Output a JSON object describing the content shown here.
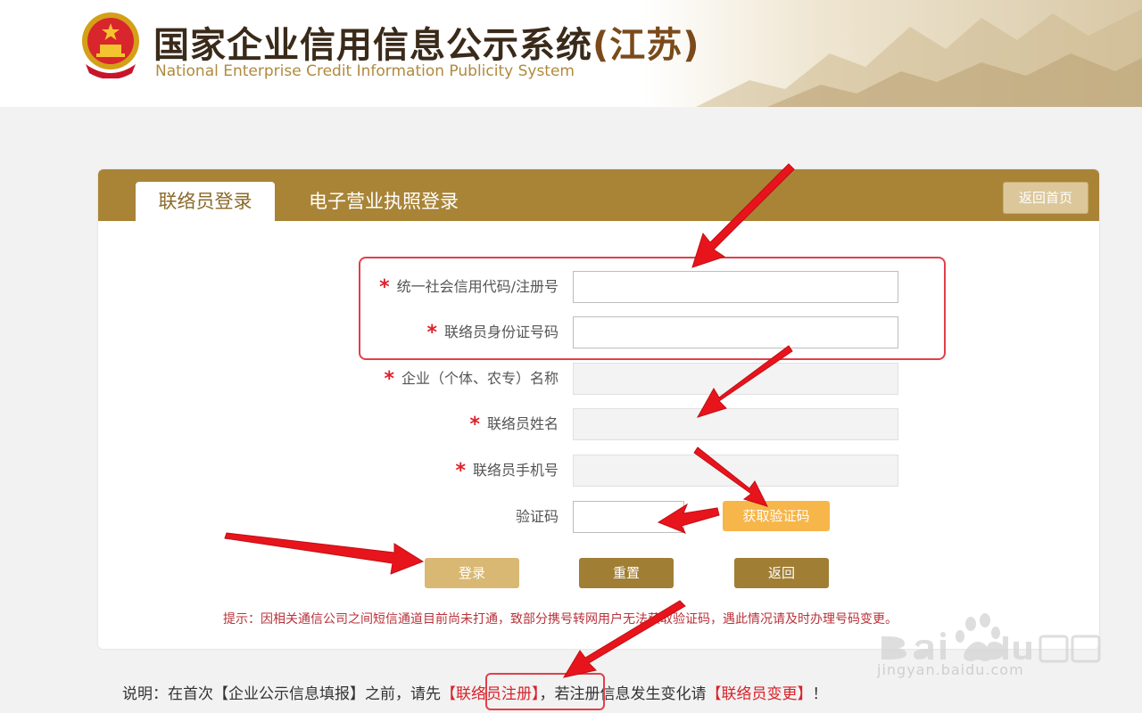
{
  "header": {
    "title_cn": "国家企业信用信息公示系统",
    "title_prov": "(江苏)",
    "title_en": "National Enterprise Credit Information Publicity System"
  },
  "tabs": [
    {
      "label": "联络员登录",
      "active": true
    },
    {
      "label": "电子营业执照登录",
      "active": false
    }
  ],
  "home_button": "返回首页",
  "form": {
    "fields": [
      {
        "label": "统一社会信用代码/注册号",
        "required": true,
        "value": "",
        "readonly": false
      },
      {
        "label": "联络员身份证号码",
        "required": true,
        "value": "",
        "readonly": false
      },
      {
        "label": "企业（个体、农专）名称",
        "required": true,
        "value": "",
        "readonly": true
      },
      {
        "label": "联络员姓名",
        "required": true,
        "value": "",
        "readonly": true
      },
      {
        "label": "联络员手机号",
        "required": true,
        "value": "",
        "readonly": true
      }
    ],
    "captcha": {
      "label": "验证码",
      "value": "",
      "button": "获取验证码"
    },
    "star": "*"
  },
  "buttons": {
    "login": "登录",
    "reset": "重置",
    "back": "返回"
  },
  "tip": "提示：因相关通信公司之间短信通道目前尚未打通，致部分携号转网用户无法获取验证码，遇此情况请及时办理号码变更。",
  "note": {
    "prefix": "说明：在首次【企业公示信息填报】之前，请先",
    "register_link": "【联络员注册】",
    "middle": "，若注册信息发生变化请",
    "change_link": "【联络员变更】",
    "suffix": "！"
  },
  "watermark": {
    "text": "jingyan.baidu.com"
  },
  "colors": {
    "brand": "#a98437",
    "accent_red": "#e0202a",
    "code_button": "#f6b64a",
    "arrow": "#e8141c"
  }
}
